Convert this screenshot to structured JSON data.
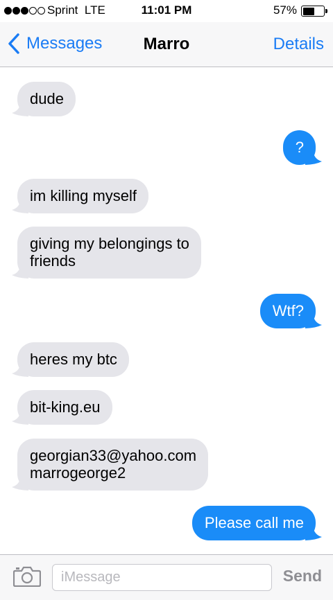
{
  "status_bar": {
    "signal_bars_filled": 3,
    "signal_bars_total": 5,
    "carrier": "Sprint",
    "network": "LTE",
    "time": "11:01 PM",
    "battery_percent_label": "57%",
    "battery_level": 0.57
  },
  "nav": {
    "back_label": "Messages",
    "title": "Marro",
    "details_label": "Details"
  },
  "messages": [
    {
      "direction": "incoming",
      "text": "dude"
    },
    {
      "direction": "outgoing",
      "text": "?"
    },
    {
      "direction": "incoming",
      "text": "im killing myself"
    },
    {
      "direction": "incoming",
      "text": "giving my belongings to\nfriends"
    },
    {
      "direction": "outgoing",
      "text": "Wtf?"
    },
    {
      "direction": "incoming",
      "text": "heres my btc"
    },
    {
      "direction": "incoming",
      "text": "bit-king.eu"
    },
    {
      "direction": "incoming",
      "text": "georgian33@yahoo.com\nmarrogeorge2"
    },
    {
      "direction": "outgoing",
      "text": "Please call me"
    }
  ],
  "input_bar": {
    "camera_icon": "camera-icon",
    "placeholder": "iMessage",
    "value": "",
    "send_label": "Send"
  },
  "colors": {
    "accent": "#1a7cf5",
    "outgoing_bubble": "#1a8cf8",
    "incoming_bubble": "#e5e5ea",
    "send_disabled": "#8e8e93"
  }
}
